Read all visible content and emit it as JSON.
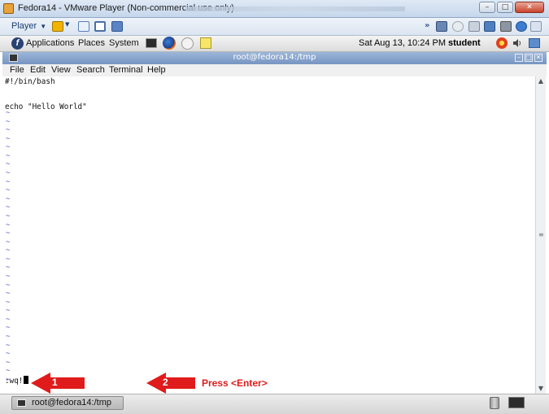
{
  "vmware": {
    "title": "Fedora14 - VMware Player (Non-commercial use only)",
    "player_menu": "Player"
  },
  "gnome_panel": {
    "applications": "Applications",
    "places": "Places",
    "system": "System",
    "clock": "Sat Aug 13, 10:24 PM",
    "user": "student"
  },
  "terminal": {
    "title": "root@fedora14:/tmp",
    "menu": [
      "File",
      "Edit",
      "View",
      "Search",
      "Terminal",
      "Help"
    ],
    "lines": [
      "#!/bin/bash",
      "",
      "echo \"Hello World\""
    ],
    "tilde_rows": 32,
    "command": ":wq!"
  },
  "annotations": {
    "step1": "1",
    "step2": "2",
    "press_label": "Press <Enter>",
    "color": "#e01b1b"
  },
  "taskbar": {
    "item_label": "root@fedora14:/tmp"
  }
}
